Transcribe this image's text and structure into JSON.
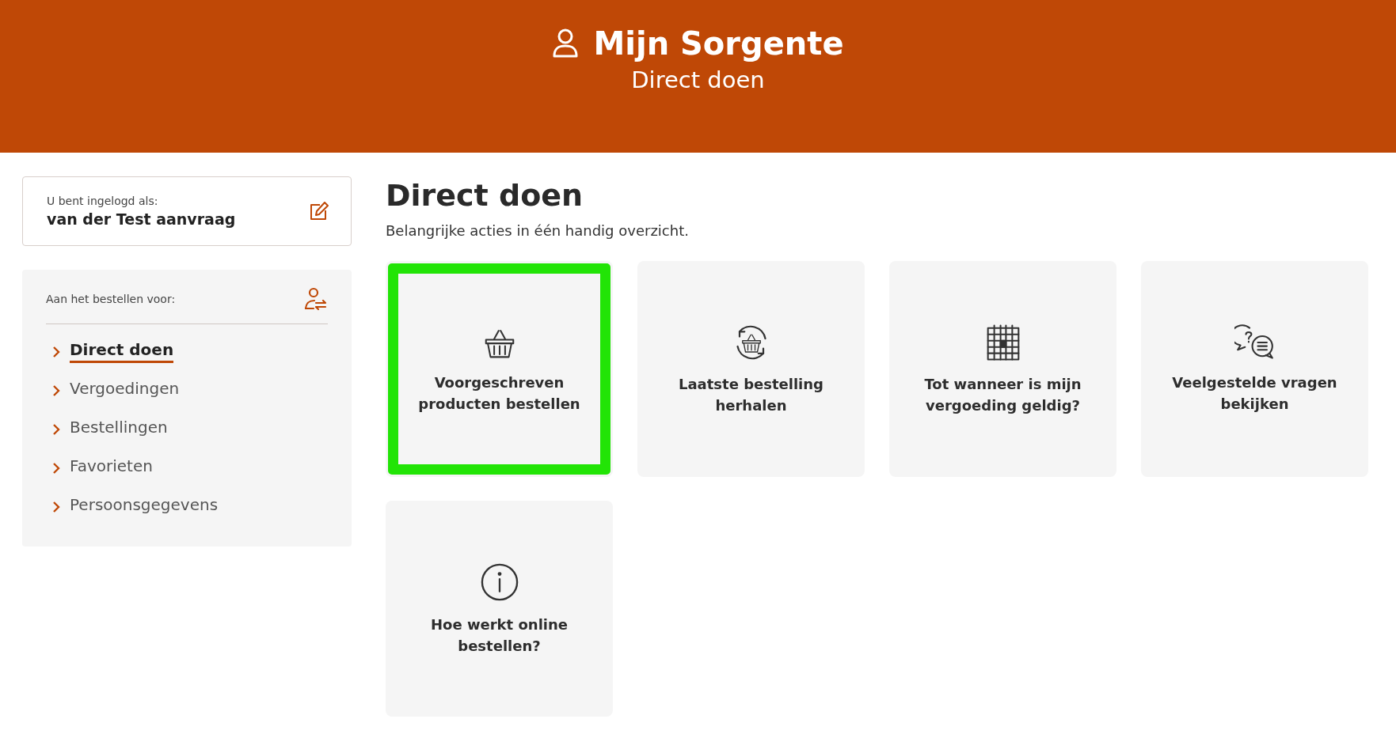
{
  "header": {
    "title": "Mijn Sorgente",
    "subtitle": "Direct doen"
  },
  "login": {
    "label": "U bent ingelogd als:",
    "name": "van der Test aanvraag"
  },
  "ordering_for": {
    "label": "Aan het bestellen voor:"
  },
  "nav": [
    {
      "label": "Direct doen",
      "selected": true
    },
    {
      "label": "Vergoedingen",
      "selected": false
    },
    {
      "label": "Bestellingen",
      "selected": false
    },
    {
      "label": "Favorieten",
      "selected": false
    },
    {
      "label": "Persoonsgegevens",
      "selected": false
    }
  ],
  "page": {
    "title": "Direct doen",
    "intro": "Belangrijke acties in één handig overzicht."
  },
  "actions": [
    {
      "kind": "basket",
      "label": "Voorgeschreven producten bestellen",
      "selected": true
    },
    {
      "kind": "repeat",
      "label": "Laatste bestelling herhalen",
      "selected": false
    },
    {
      "kind": "calendar",
      "label": "Tot wanneer is mijn vergoeding geldig?",
      "selected": false
    },
    {
      "kind": "faq",
      "label": "Veelgestelde vragen bekijken",
      "selected": false
    },
    {
      "kind": "info",
      "label": "Hoe werkt online bestellen?",
      "selected": false
    }
  ]
}
